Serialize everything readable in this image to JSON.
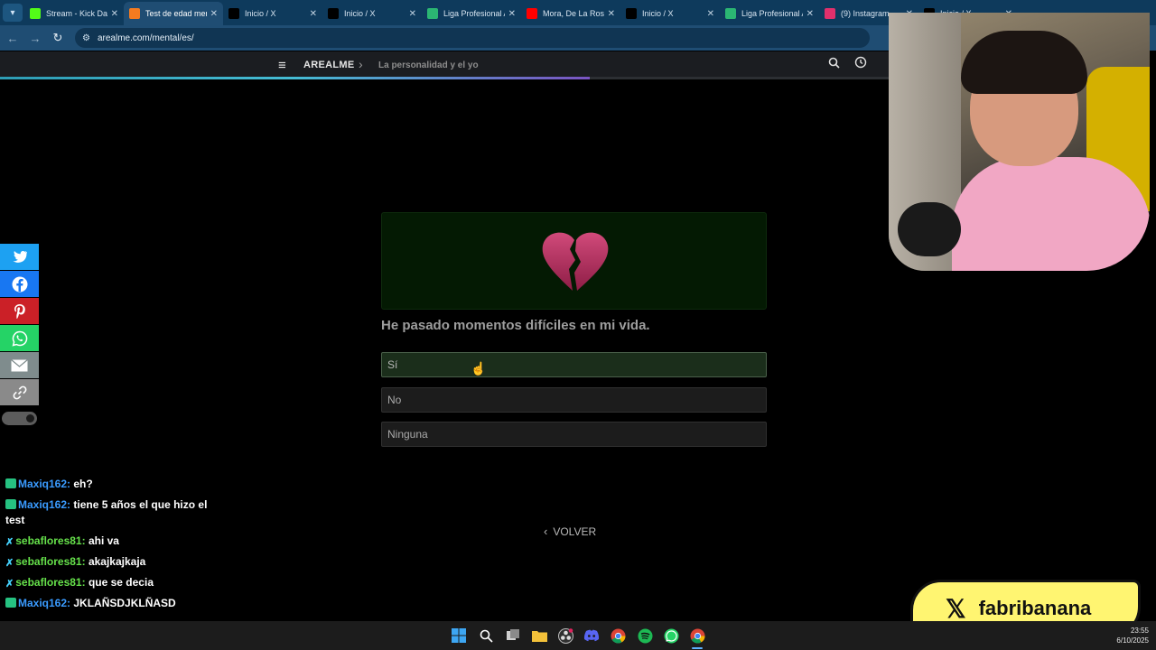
{
  "browser": {
    "tabs": [
      {
        "title": "Stream - Kick Das",
        "icon": "kick-icon",
        "color": "#53fc18",
        "active": false
      },
      {
        "title": "Test de edad men",
        "icon": "arealme-icon",
        "color": "#f47b20",
        "active": true
      },
      {
        "title": "Inicio / X",
        "icon": "x-icon",
        "color": "#000000",
        "active": false
      },
      {
        "title": "Inicio / X",
        "icon": "x-icon",
        "color": "#000000",
        "active": false
      },
      {
        "title": "Liga Profesional A",
        "icon": "liga-icon",
        "color": "#2bb673",
        "active": false
      },
      {
        "title": "Mora, De La Rose",
        "icon": "youtube-icon",
        "color": "#ff0000",
        "active": false
      },
      {
        "title": "Inicio / X",
        "icon": "x-icon",
        "color": "#000000",
        "active": false
      },
      {
        "title": "Liga Profesional A",
        "icon": "liga-icon",
        "color": "#2bb673",
        "active": false
      },
      {
        "title": "(9) Instagram",
        "icon": "instagram-icon",
        "color": "#e1306c",
        "active": false
      },
      {
        "title": "Inicio / X",
        "icon": "x-icon",
        "color": "#000000",
        "active": false
      }
    ],
    "url": "arealme.com/mental/es/"
  },
  "site": {
    "brand": "AREALME",
    "breadcrumb": "La personalidad y el yo",
    "progress": 0.66
  },
  "quiz": {
    "emoji": "💔",
    "question": "He pasado momentos difíciles en mi vida.",
    "answers": [
      "Sí",
      "No",
      "Ninguna"
    ],
    "hovered_answer": "Sí",
    "back_label": "VOLVER"
  },
  "share_buttons": [
    "twitter",
    "facebook",
    "pinterest",
    "whatsapp",
    "email",
    "link"
  ],
  "chat": [
    {
      "user": "Maxiq162",
      "text": "eh?",
      "badge": "sub",
      "user_color": "#3a9bff"
    },
    {
      "user": "Maxiq162",
      "text": "tiene 5 años el que hizo el test",
      "badge": "sub",
      "user_color": "#3a9bff"
    },
    {
      "user": "sebaflores81",
      "text": "ahi va",
      "badge": "sword",
      "user_color": "#66e24b"
    },
    {
      "user": "sebaflores81",
      "text": "akajkajkaja",
      "badge": "sword",
      "user_color": "#66e24b"
    },
    {
      "user": "sebaflores81",
      "text": "que se decia",
      "badge": "sword",
      "user_color": "#66e24b"
    },
    {
      "user": "Maxiq162",
      "text": "JKLAÑSDJKLÑASD",
      "badge": "sub",
      "user_color": "#3a9bff"
    }
  ],
  "streamer": {
    "handle": "fabribanana"
  },
  "taskbar": {
    "time": "23:55",
    "date": "6/10/2025"
  }
}
